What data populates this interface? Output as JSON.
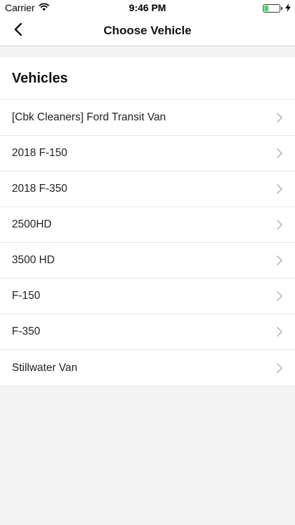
{
  "status_bar": {
    "carrier": "Carrier",
    "time": "9:46 PM",
    "battery_color": "#4cd964"
  },
  "nav": {
    "title": "Choose Vehicle",
    "back_icon": "chevron-left-icon"
  },
  "section": {
    "title": "Vehicles"
  },
  "vehicles": [
    {
      "label": "[Cbk Cleaners] Ford Transit Van"
    },
    {
      "label": "2018 F-150"
    },
    {
      "label": "2018 F-350"
    },
    {
      "label": "2500HD"
    },
    {
      "label": "3500 HD"
    },
    {
      "label": "F-150"
    },
    {
      "label": "F-350"
    },
    {
      "label": "Stillwater Van"
    }
  ]
}
